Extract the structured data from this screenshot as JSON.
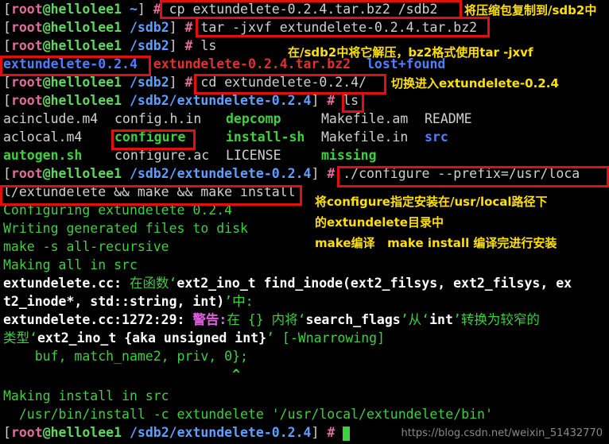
{
  "prompt": {
    "user": "root",
    "host": "hellolee1",
    "dir_home": "~",
    "dir_sdb2": "/sdb2",
    "dir_ext": "/sdb2/extundelete-0.2.4"
  },
  "commands": {
    "cp": "cp extundelete-0.2.4.tar.bz2 /sdb2",
    "tar": "tar -jxvf extundelete-0.2.4.tar.bz2",
    "ls1": "ls",
    "cd": "cd extundelete-0.2.4/",
    "ls2": "ls",
    "configure_a": "./configure --prefix=/usr/loca",
    "configure_b": "l/extundelete && make && make install"
  },
  "ls_output_1": {
    "dir": "extundelete-0.2.4",
    "archive": "extundelete-0.2.4.tar.bz2",
    "lost": "lost+found"
  },
  "ls_output_2": {
    "r1": [
      "acinclude.m4",
      "config.h.in",
      "depcomp",
      "Makefile.am",
      "README"
    ],
    "r2": [
      "aclocal.m4",
      "configure",
      "install-sh",
      "Makefile.in",
      "src"
    ],
    "r3": [
      "autogen.sh",
      "configure.ac",
      "LICENSE",
      "missing"
    ]
  },
  "output": {
    "o1": "Configuring extundelete 0.2.4",
    "o2": "Writing generated files to disk",
    "o3": "make -s all-recursive",
    "o4": "Making all in src",
    "o5a": "extundelete.cc:",
    "o5b": " 在函数‘",
    "o5c": "ext2_ino_t find_inode(ext2_filsys, ext2_filsys, ex",
    "o6a": "t2_inode*, std::string, int)",
    "o6b": "’中:",
    "o7a": "extundelete.cc:1272:29:",
    "o7b": " 警告:",
    "o7c": "在 {} 内将‘",
    "o7d": "search_flags",
    "o7e": "’从‘",
    "o7f": "int",
    "o7g": "’转换为较窄的",
    "o8a": "类型‘",
    "o8b": "ext2_ino_t {aka unsigned int}",
    "o8c": "’ [-Wnarrowing]",
    "o9": "    buf, match_name2, priv, 0};",
    "o10": "                             ^",
    "o11": "Making install in src",
    "o12": "  /usr/bin/install -c extundelete '/usr/local/extundelete/bin'"
  },
  "notes": {
    "n1": "将压缩包复制到/sdb2中",
    "n2": "在/sdb2中将它解压，bz2格式使用tar -jxvf",
    "n3": "切换进入extundelete-0.2.4",
    "n4": "将configure指定安装在/usr/local路径下",
    "n5": "的extundelete目录中",
    "n6": "make编译   make install 编译完进行安装"
  },
  "watermark": "https://blog.csdn.net/weixin_51432770"
}
